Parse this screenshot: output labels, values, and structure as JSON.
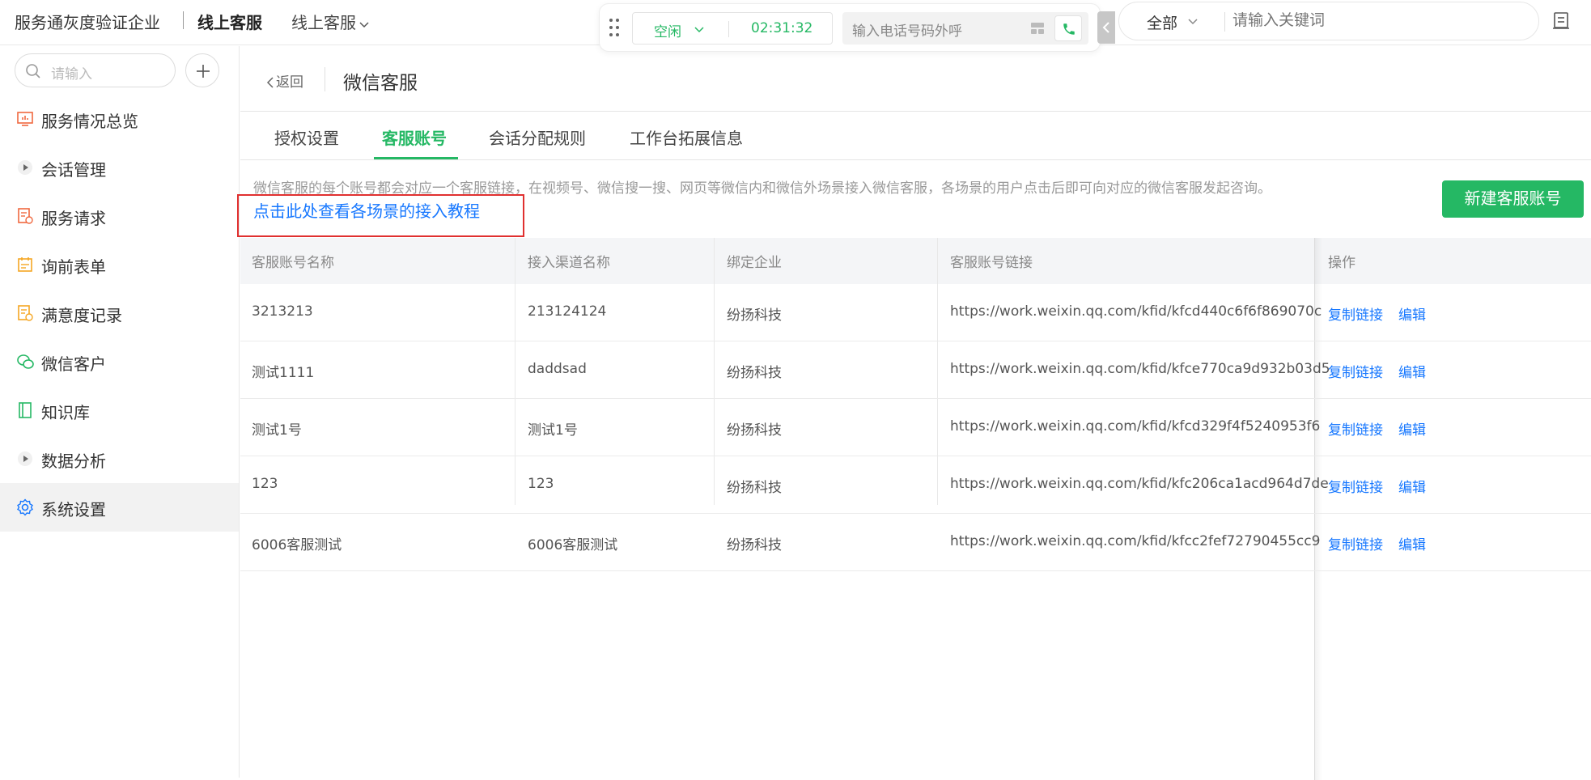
{
  "header": {
    "org_name": "服务通灰度验证企业",
    "product_name": "线上客服",
    "product_switch_label": "线上客服",
    "agent_status": "空闲",
    "call_timer": "02:31:32",
    "dial_placeholder": "输入电话号码外呼",
    "search_scope": "全部",
    "search_placeholder": "请输入关键词"
  },
  "sidebar": {
    "search_placeholder": "请输入",
    "items": [
      {
        "label": "服务情况总览",
        "icon": "monitor-icon"
      },
      {
        "label": "会话管理",
        "icon": "play-icon"
      },
      {
        "label": "服务请求",
        "icon": "document-icon"
      },
      {
        "label": "询前表单",
        "icon": "calendar-icon"
      },
      {
        "label": "满意度记录",
        "icon": "rating-icon"
      },
      {
        "label": "微信客户",
        "icon": "wechat-icon"
      },
      {
        "label": "知识库",
        "icon": "book-icon"
      },
      {
        "label": "数据分析",
        "icon": "play-icon"
      },
      {
        "label": "系统设置",
        "icon": "gear-icon"
      }
    ]
  },
  "page": {
    "back_label": "返回",
    "title": "微信客服",
    "tabs": [
      "授权设置",
      "客服账号",
      "会话分配规则",
      "工作台拓展信息"
    ],
    "active_tab": "客服账号",
    "description": "微信客服的每个账号都会对应一个客服链接，在视频号、微信搜一搜、网页等微信内和微信外场景接入微信客服，各场景的用户点击后即可向对应的微信客服发起咨询。",
    "tutorial_link": "点击此处查看各场景的接入教程",
    "new_button": "新建客服账号"
  },
  "table": {
    "columns": [
      "客服账号名称",
      "接入渠道名称",
      "绑定企业",
      "客服账号链接",
      "操作"
    ],
    "rows": [
      {
        "name": "3213213",
        "channel": "213124124",
        "company": "纷扬科技",
        "link": "https://work.weixin.qq.com/kfid/kfcd440c6f6f869070c"
      },
      {
        "name": "测试1111",
        "channel": "daddsad",
        "company": "纷扬科技",
        "link": "https://work.weixin.qq.com/kfid/kfce770ca9d932b03d5"
      },
      {
        "name": "测试1号",
        "channel": "测试1号",
        "company": "纷扬科技",
        "link": "https://work.weixin.qq.com/kfid/kfcd329f4f5240953f6"
      },
      {
        "name": "123",
        "channel": "123",
        "company": "纷扬科技",
        "link": "https://work.weixin.qq.com/kfid/kfc206ca1acd964d7de"
      },
      {
        "name": "6006客服测试",
        "channel": "6006客服测试",
        "company": "纷扬科技",
        "link": "https://work.weixin.qq.com/kfid/kfcc2fef72790455cc9"
      }
    ],
    "actions": {
      "copy": "复制链接",
      "edit": "编辑"
    }
  },
  "colors": {
    "brand_green": "#25b864",
    "link_blue": "#1677ff",
    "highlight_red": "#e0302f"
  }
}
